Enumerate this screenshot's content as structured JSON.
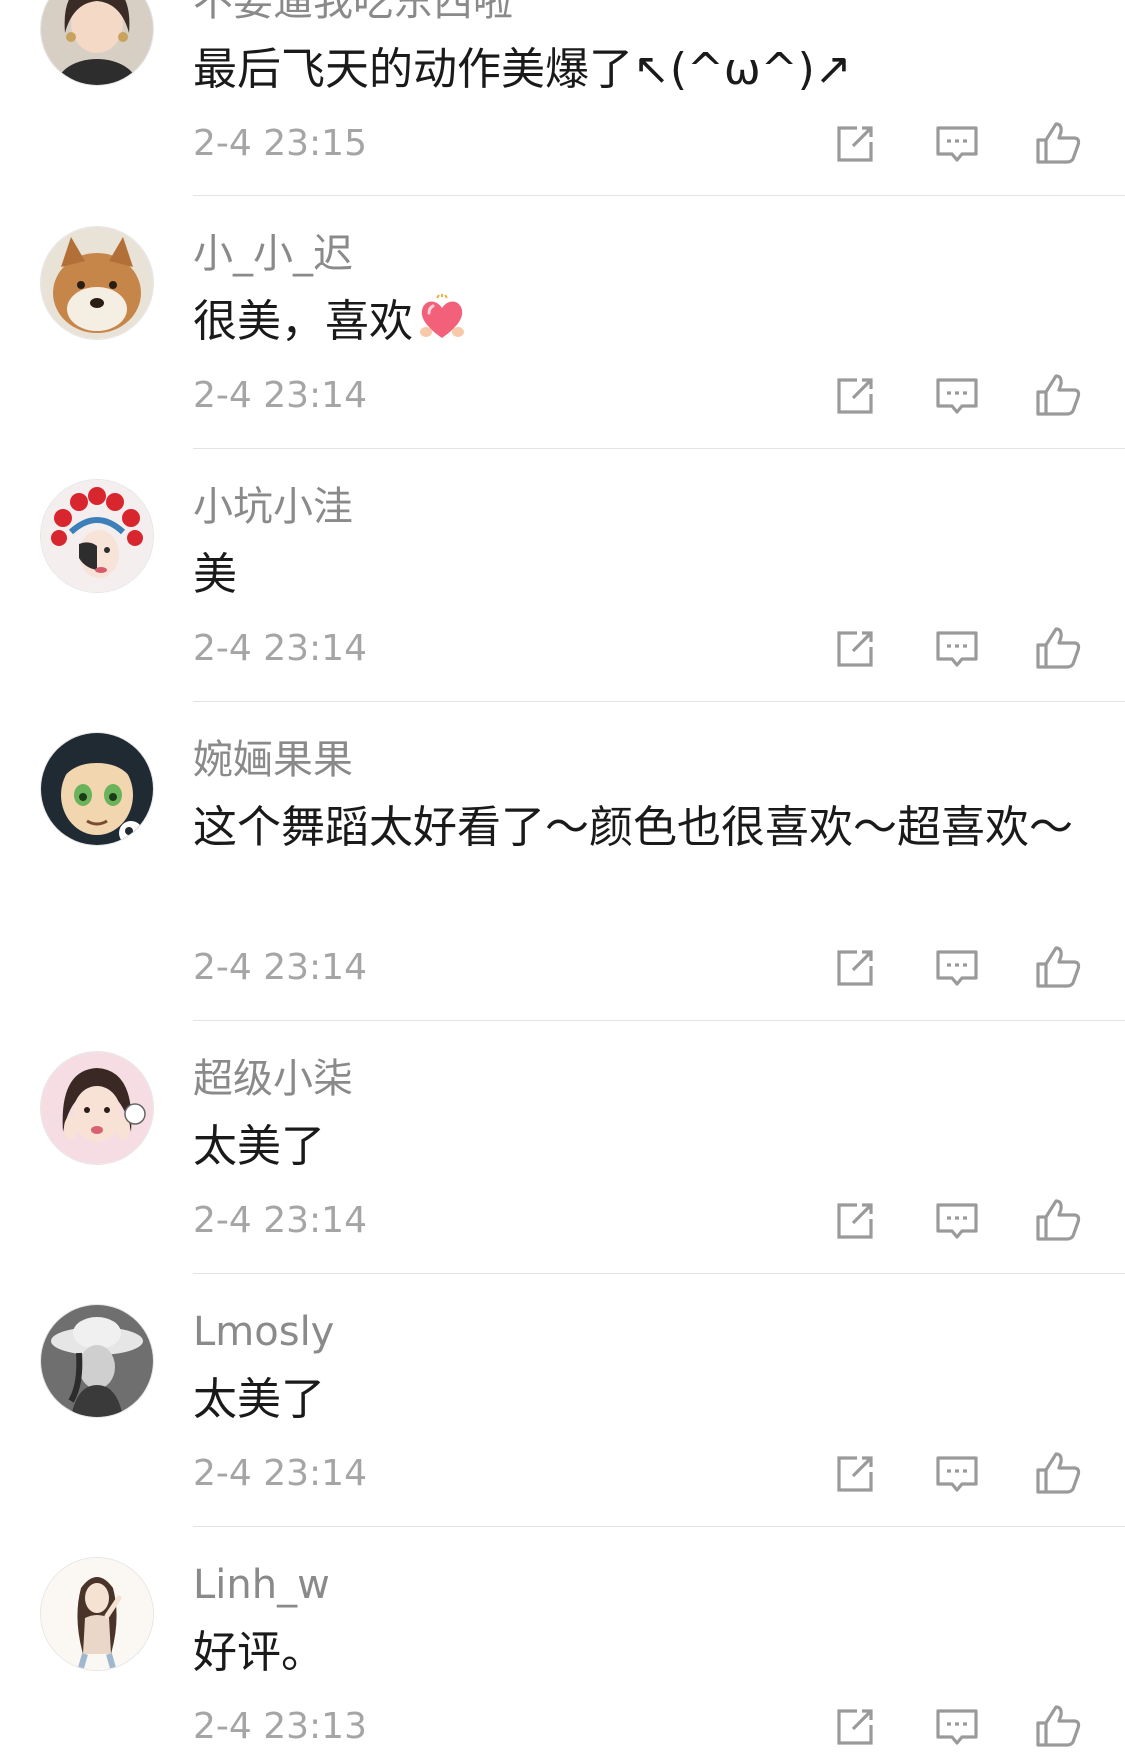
{
  "comments": [
    {
      "username": "不要逼我吃东西啦",
      "content": "最后飞天的动作美爆了↖(^ω^)↗",
      "timestamp": "2-4 23:15",
      "avatar": "avatar-girl-photo"
    },
    {
      "username": "小_小_迟",
      "content": "很美，喜欢",
      "content_emoji": "heart-emoji",
      "timestamp": "2-4 23:14",
      "avatar": "avatar-shiba-dog"
    },
    {
      "username": "小坑小洼",
      "content": "美",
      "timestamp": "2-4 23:14",
      "avatar": "avatar-opera-headdress"
    },
    {
      "username": "婉婳果果",
      "content": "这个舞蹈太好看了～颜色也很喜欢～超喜欢～",
      "timestamp": "2-4 23:14",
      "avatar": "avatar-cartoon-face"
    },
    {
      "username": "超级小柒",
      "content": "太美了",
      "timestamp": "2-4 23:14",
      "avatar": "avatar-girl-pink"
    },
    {
      "username": "Lmosly",
      "content": "太美了",
      "timestamp": "2-4 23:14",
      "avatar": "avatar-girl-hat-bw"
    },
    {
      "username": "Linh_w",
      "content": "好评。",
      "timestamp": "2-4 23:13",
      "avatar": "avatar-girl-drawing"
    }
  ],
  "icons": {
    "repost": "repost-icon",
    "reply": "comment-icon",
    "like": "thumbs-up-icon"
  },
  "colors": {
    "username": "#8a8a8a",
    "content": "#1a1a1a",
    "timestamp": "#a5a5a5",
    "icon": "#9a9a9a",
    "divider": "#e3e3e3"
  }
}
